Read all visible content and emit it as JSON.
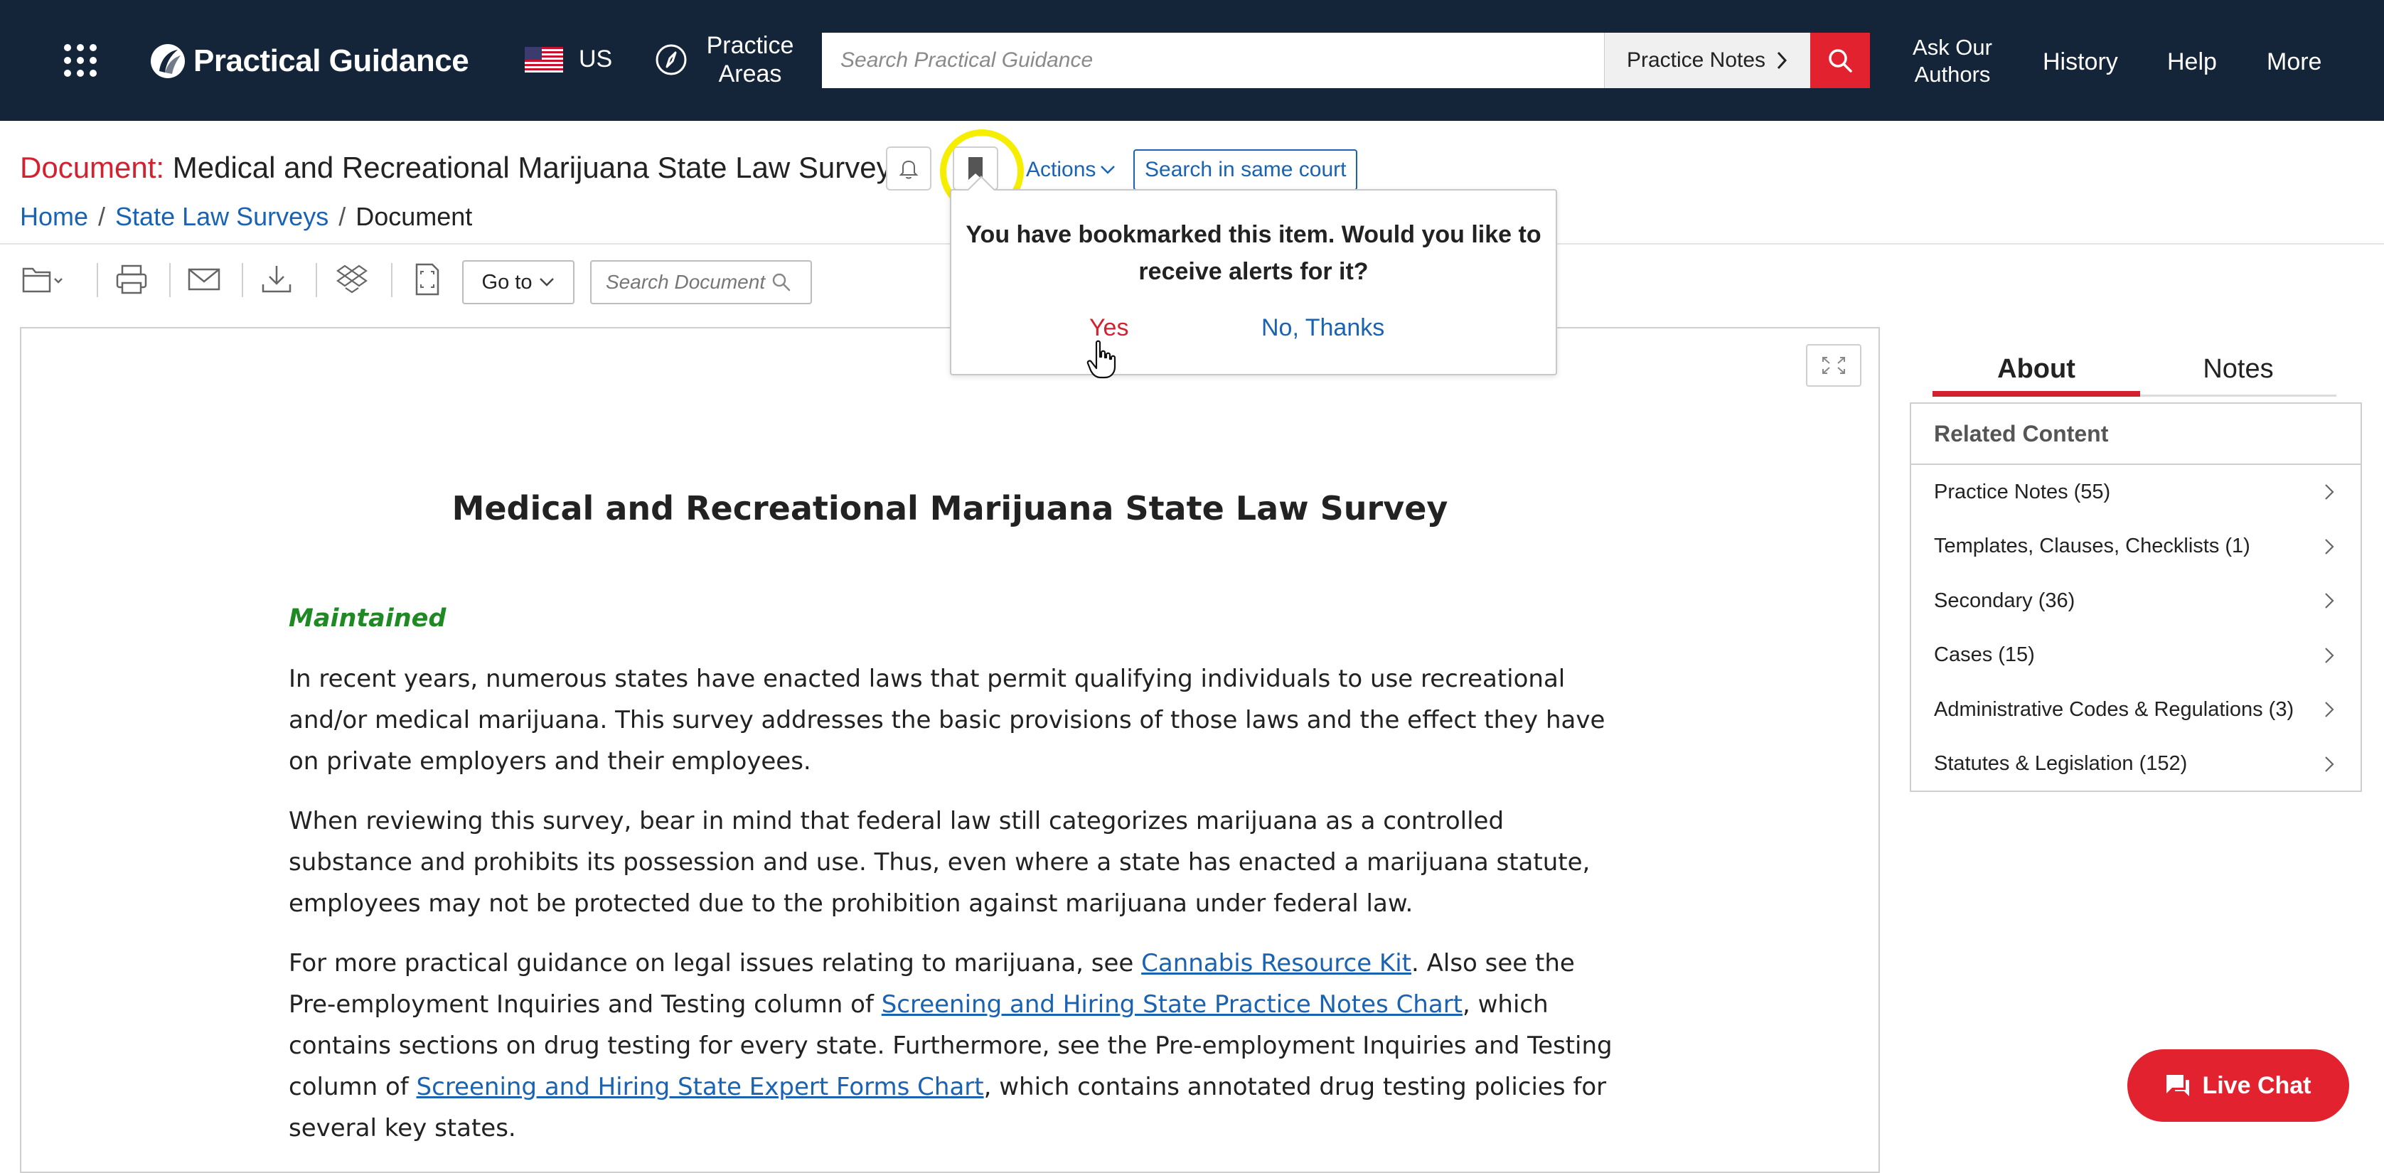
{
  "topbar": {
    "brand": "Practical Guidance",
    "region": "US",
    "practice_areas": "Practice Areas",
    "search_placeholder": "Search Practical Guidance",
    "search_scope": "Practice Notes",
    "ask_authors": "Ask Our Authors",
    "history": "History",
    "help": "Help",
    "more": "More"
  },
  "doc_header": {
    "label": "Document:",
    "title": "Medical and Recreational Marijuana State Law Survey",
    "actions": "Actions",
    "search_same_court": "Search in same court",
    "breadcrumb": [
      "Home",
      "State Law Surveys",
      "Document"
    ]
  },
  "toolbar": {
    "goto": "Go to",
    "search_placeholder": "Search Document"
  },
  "popover": {
    "message": "You have bookmarked this item. Would you like to receive alerts for it?",
    "yes": "Yes",
    "no": "No, Thanks"
  },
  "document": {
    "heading": "Medical and Recreational Marijuana State Law Survey",
    "status": "Maintained",
    "p1": "In recent years, numerous states have enacted laws that permit qualifying individuals to use recreational and/or medical marijuana. This survey addresses the basic provisions of those laws and the effect they have on private employers and their employees.",
    "p2": "When reviewing this survey, bear in mind that federal law still categorizes marijuana as a controlled substance and prohibits its possession and use. Thus, even where a state has enacted a marijuana statute, employees may not be protected due to the prohibition against marijuana under federal law.",
    "p3_a": "For more practical guidance on legal issues relating to marijuana, see ",
    "p3_link1": "Cannabis Resource Kit",
    "p3_b": ". Also see the Pre-employment Inquiries and Testing column of ",
    "p3_link2": "Screening and Hiring State Practice Notes Chart",
    "p3_c": ", which contains sections on drug testing for every state. Furthermore, see the Pre-employment Inquiries and Testing column of ",
    "p3_link3": "Screening and Hiring State Expert Forms Chart",
    "p3_d": ", which contains annotated drug testing policies for several key states."
  },
  "side_panel": {
    "tab_about": "About",
    "tab_notes": "Notes",
    "related_title": "Related Content",
    "related_items": [
      "Practice Notes (55)",
      "Templates, Clauses, Checklists (1)",
      "Secondary (36)",
      "Cases (15)",
      "Administrative Codes & Regulations (3)",
      "Statutes & Legislation (152)"
    ]
  },
  "live_chat": "Live Chat",
  "colors": {
    "topbar": "#14253a",
    "accent_red": "#e3222f",
    "link_blue": "#1a63b3",
    "highlight_yellow": "#f6ee00",
    "maintained_green": "#1f8a24"
  }
}
